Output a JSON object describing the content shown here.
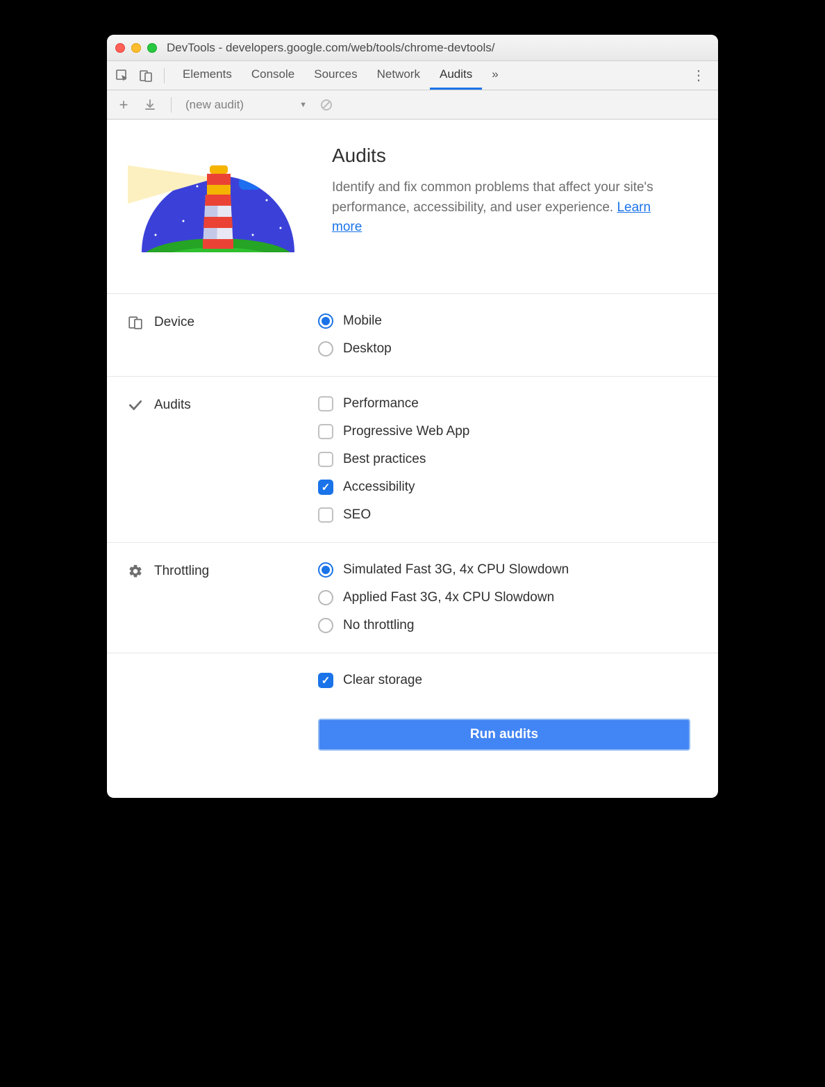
{
  "window": {
    "title": "DevTools - developers.google.com/web/tools/chrome-devtools/"
  },
  "tabs": {
    "items": [
      "Elements",
      "Console",
      "Sources",
      "Network",
      "Audits"
    ],
    "active": "Audits"
  },
  "toolbar": {
    "audit_select": "(new audit)"
  },
  "header": {
    "title": "Audits",
    "desc": "Identify and fix common problems that affect your site's performance, accessibility, and user experience. ",
    "learn_more": "Learn more"
  },
  "sections": {
    "device": {
      "label": "Device",
      "options": [
        {
          "label": "Mobile",
          "checked": true
        },
        {
          "label": "Desktop",
          "checked": false
        }
      ]
    },
    "audits": {
      "label": "Audits",
      "options": [
        {
          "label": "Performance",
          "checked": false
        },
        {
          "label": "Progressive Web App",
          "checked": false
        },
        {
          "label": "Best practices",
          "checked": false
        },
        {
          "label": "Accessibility",
          "checked": true
        },
        {
          "label": "SEO",
          "checked": false
        }
      ]
    },
    "throttling": {
      "label": "Throttling",
      "options": [
        {
          "label": "Simulated Fast 3G, 4x CPU Slowdown",
          "checked": true
        },
        {
          "label": "Applied Fast 3G, 4x CPU Slowdown",
          "checked": false
        },
        {
          "label": "No throttling",
          "checked": false
        }
      ]
    },
    "clear_storage": {
      "label": "Clear storage",
      "checked": true
    }
  },
  "run_button": "Run audits"
}
